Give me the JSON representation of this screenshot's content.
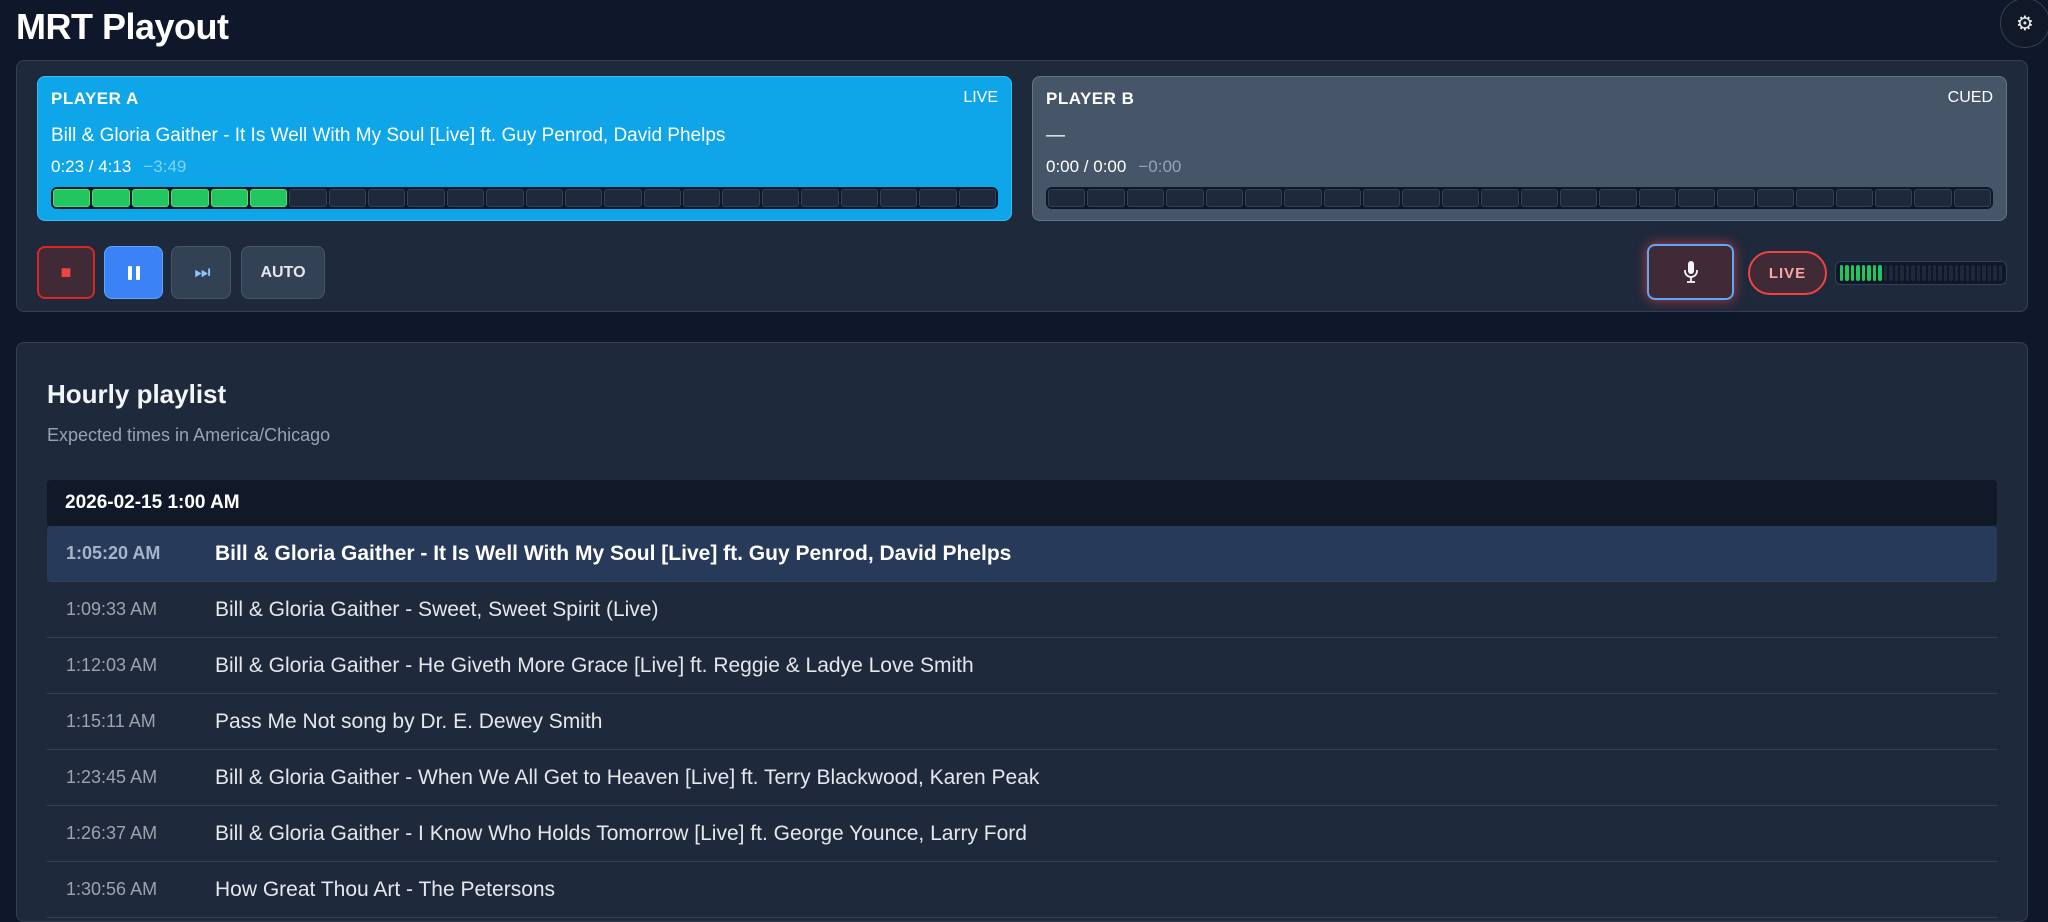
{
  "app": {
    "title": "MRT Playout",
    "settings_icon": "⚙"
  },
  "players": [
    {
      "name": "PLAYER A",
      "state": "LIVE",
      "track": "Bill & Gloria Gaither - It Is Well With My Soul [Live] ft. Guy Penrod, David Phelps",
      "time": "0:23 / 4:13",
      "remaining": "−3:49",
      "progress_segments": 24,
      "progress_filled": 6
    },
    {
      "name": "PLAYER B",
      "state": "CUED",
      "track": "—",
      "time": "0:00 / 0:00",
      "remaining": "−0:00",
      "progress_segments": 24,
      "progress_filled": 0
    }
  ],
  "controls": {
    "stop_icon": "■",
    "pause_icon": "pause-icon",
    "next_icon": "⏭",
    "auto_label": "AUTO",
    "mic_icon": "microphone-icon",
    "live_label": "LIVE",
    "meter_segments": 30,
    "meter_level": 0.27
  },
  "playlist": {
    "title": "Hourly playlist",
    "subtitle": "Expected times in America/Chicago",
    "hour_header": "2026-02-15 1:00 AM",
    "rows": [
      {
        "time": "1:05:20 AM",
        "track": "Bill & Gloria Gaither - It Is Well With My Soul [Live] ft. Guy Penrod, David Phelps",
        "current": true
      },
      {
        "time": "1:09:33 AM",
        "track": "Bill & Gloria Gaither - Sweet, Sweet Spirit (Live)",
        "current": false
      },
      {
        "time": "1:12:03 AM",
        "track": "Bill & Gloria Gaither - He Giveth More Grace [Live] ft. Reggie & Ladye Love Smith",
        "current": false
      },
      {
        "time": "1:15:11 AM",
        "track": "Pass Me Not song by Dr. E. Dewey Smith",
        "current": false
      },
      {
        "time": "1:23:45 AM",
        "track": "Bill & Gloria Gaither - When We All Get to Heaven [Live] ft. Terry Blackwood, Karen Peak",
        "current": false
      },
      {
        "time": "1:26:37 AM",
        "track": "Bill & Gloria Gaither - I Know Who Holds Tomorrow [Live] ft. George Younce, Larry Ford",
        "current": false
      },
      {
        "time": "1:30:56 AM",
        "track": "How Great Thou Art - The Petersons",
        "current": false
      }
    ]
  }
}
